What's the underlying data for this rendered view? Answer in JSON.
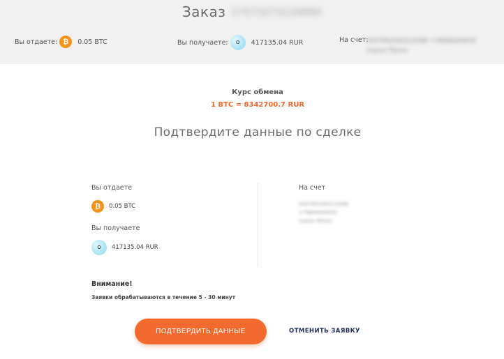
{
  "header": {
    "title": "Заказ",
    "order_number": "17573273134884"
  },
  "summary": {
    "give_label": "Вы отдаете:",
    "give_amount": "0.05 BTC",
    "receive_label": "Вы получаете:",
    "receive_amount": "417135.04 RUR",
    "account_label": "На счет:",
    "account_lines": [
      "0437952302212096 +79806400030",
      "Ivanov Petrov"
    ]
  },
  "rate": {
    "label": "Курс обмена",
    "value": "1 BTC = 8342700.7 RUR"
  },
  "confirm_heading": "Подтвердите данные по сделке",
  "details": {
    "give_label": "Вы отдаете",
    "give_amount": "0.05 BTC",
    "receive_label": "Вы получаете",
    "receive_amount": "417135.04 RUR",
    "account_label": "На счет",
    "account_lines": [
      "0437952302212096",
      "+79806400030",
      "Ivanov Petrov"
    ]
  },
  "notice": {
    "title": "Внимание!",
    "text": "Заявки обрабатываются в течение 5 - 30 минут"
  },
  "actions": {
    "confirm_label": "ПОДТВЕРДИТЬ ДАННЫЕ",
    "cancel_label": "ОТМЕНИТЬ ЗАЯВКУ"
  },
  "icons": {
    "btc_symbol": "₿",
    "rur_symbol": "o"
  },
  "colors": {
    "accent": "#f26a2e",
    "btc": "#f7931a",
    "cancel_link": "#1f2d5a",
    "top_band": "#f1f1f1"
  }
}
